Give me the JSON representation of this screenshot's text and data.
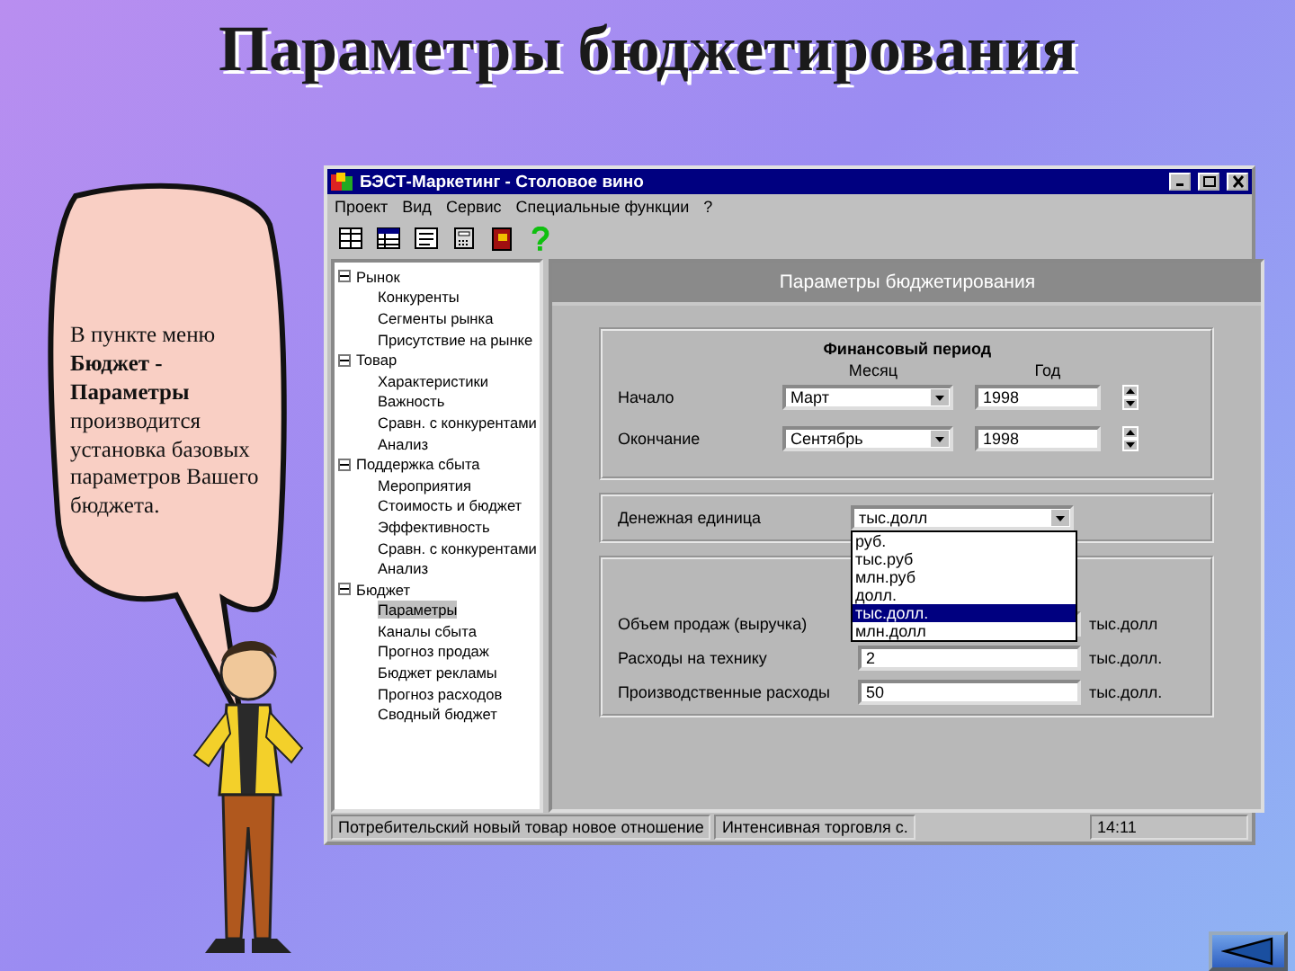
{
  "slide": {
    "title": "Параметры бюджетирования",
    "callout": "В пункте меню **Бюджет - Параметры** производится установка базовых параметров Вашего бюджета."
  },
  "window": {
    "title": "БЭСТ-Маркетинг - Столовое вино"
  },
  "menu": [
    "Проект",
    "Вид",
    "Сервис",
    "Специальные функции",
    "?"
  ],
  "tree": [
    {
      "label": "Рынок",
      "expanded": true,
      "children": [
        {
          "label": "Конкуренты",
          "selected": false
        },
        {
          "label": "Сегменты рынка",
          "selected": false
        },
        {
          "label": "Присутствие на рынке",
          "selected": false
        }
      ]
    },
    {
      "label": "Товар",
      "expanded": true,
      "children": [
        {
          "label": "Характеристики",
          "selected": false
        },
        {
          "label": "Важность",
          "selected": false
        },
        {
          "label": "Сравн. с конкурентами",
          "selected": false
        },
        {
          "label": "Анализ",
          "selected": false
        }
      ]
    },
    {
      "label": "Поддержка сбыта",
      "expanded": true,
      "children": [
        {
          "label": "Мероприятия",
          "selected": false
        },
        {
          "label": "Стоимость и бюджет",
          "selected": false
        },
        {
          "label": "Эффективность",
          "selected": false
        },
        {
          "label": "Сравн. с конкурентами",
          "selected": false
        },
        {
          "label": "Анализ",
          "selected": false
        }
      ]
    },
    {
      "label": "Бюджет",
      "expanded": true,
      "children": [
        {
          "label": "Параметры",
          "selected": true
        },
        {
          "label": "Каналы сбыта",
          "selected": false
        },
        {
          "label": "Прогноз продаж",
          "selected": false
        },
        {
          "label": "Бюджет рекламы",
          "selected": false
        },
        {
          "label": "Прогноз расходов",
          "selected": false
        },
        {
          "label": "Сводный бюджет",
          "selected": false
        }
      ]
    }
  ],
  "panel": {
    "header": "Параметры бюджетирования",
    "period": {
      "title": "Финансовый период",
      "month_label": "Месяц",
      "year_label": "Год",
      "rows": [
        {
          "label": "Начало",
          "month": "Март",
          "year": "1998"
        },
        {
          "label": "Окончание",
          "month": "Сентябрь",
          "year": "1998"
        }
      ]
    },
    "currency": {
      "label": "Денежная единица",
      "value": "тыс.долл",
      "expanded": true,
      "options": [
        {
          "label": "руб.",
          "selected": false
        },
        {
          "label": "тыс.руб",
          "selected": false
        },
        {
          "label": "млн.руб",
          "selected": false
        },
        {
          "label": "долл.",
          "selected": false
        },
        {
          "label": "тыс.долл.",
          "selected": true
        },
        {
          "label": "млн.долл",
          "selected": false
        }
      ]
    },
    "budget": {
      "rows": [
        {
          "label": "Объем продаж (выручка)",
          "unit": "тыс.долл"
        },
        {
          "label": "Расходы на технику",
          "value": "2",
          "unit": "тыс.долл."
        },
        {
          "label": "Производственные расходы",
          "value": "50",
          "unit": "тыс.долл."
        }
      ]
    }
  },
  "status_bar": [
    "Потребительский новый товар новое отношение",
    "Интенсивная торговля с.",
    "14:11"
  ]
}
